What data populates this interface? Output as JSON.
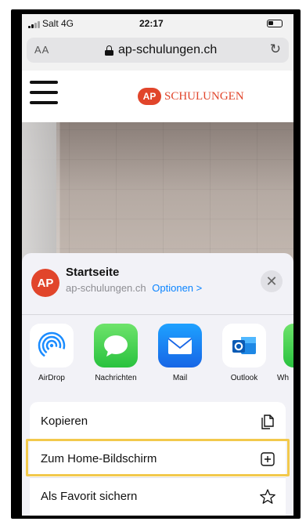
{
  "status_bar": {
    "carrier": "Salt  4G",
    "time": "22:17"
  },
  "address_bar": {
    "reader_label": "AA",
    "domain": "ap-schulungen.ch",
    "reload_icon": "reload-icon"
  },
  "site": {
    "logo_badge": "AP",
    "logo_text": "SCHULUNGEN"
  },
  "share_sheet": {
    "avatar_text": "AP",
    "title": "Startseite",
    "subtitle": "ap-schulungen.ch",
    "options_label": "Optionen >",
    "apps": [
      {
        "label": "AirDrop",
        "icon": "airdrop-icon"
      },
      {
        "label": "Nachrichten",
        "icon": "messages-icon"
      },
      {
        "label": "Mail",
        "icon": "mail-icon"
      },
      {
        "label": "Outlook",
        "icon": "outlook-icon"
      },
      {
        "label": "Wh",
        "icon": "whatsapp-icon"
      }
    ],
    "actions": [
      {
        "label": "Kopieren",
        "icon": "copy-icon"
      },
      {
        "label": "Zum Home-Bildschirm",
        "icon": "add-square-icon",
        "highlighted": true
      },
      {
        "label": "Als Favorit sichern",
        "icon": "star-icon"
      }
    ]
  },
  "colors": {
    "brand": "#e1452b",
    "highlight": "#f2c94c",
    "link": "#0a84ff"
  }
}
